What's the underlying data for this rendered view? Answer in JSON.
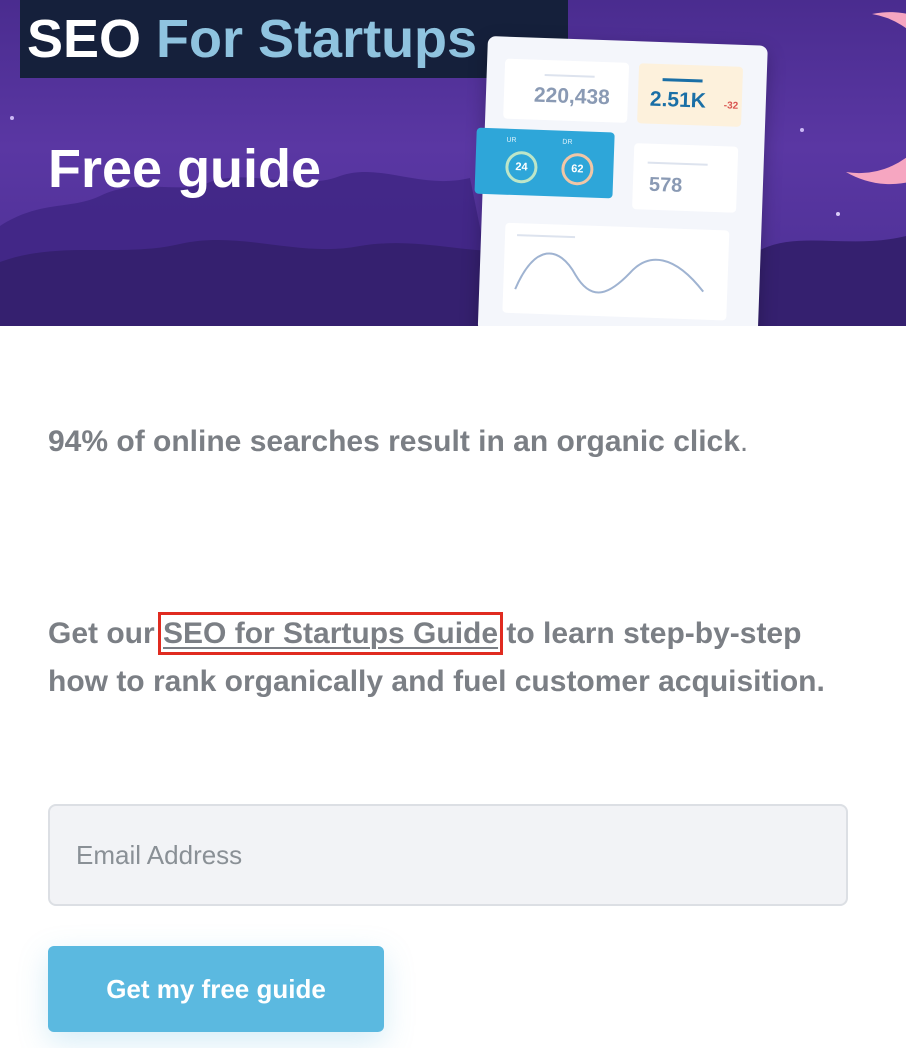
{
  "hero": {
    "brand_seo": "SEO",
    "brand_rest": " For Startups",
    "title": "Free guide",
    "dashboard": {
      "metric_1": "220,438",
      "metric_2": "2.51K",
      "metric_2_delta": "-32",
      "gauge_ur_label": "UR",
      "gauge_ur_value": "24",
      "gauge_dr_label": "DR",
      "gauge_dr_value": "62",
      "metric_3": "578"
    }
  },
  "body": {
    "stat_text": "94% of online searches result in an organic click",
    "stat_period": ".",
    "pitch_before": "Get our ",
    "pitch_link": "SEO for Startups Guide",
    "pitch_after": " to learn step-by-step how to rank organically and fuel customer acquisition."
  },
  "form": {
    "email_placeholder": "Email Address",
    "email_value": "",
    "submit_label": "Get my free guide"
  },
  "colors": {
    "hero_bg": "#4a2c8f",
    "brand_box": "#15203b",
    "brand_accent": "#8fc3df",
    "text_gray": "#7b7f85",
    "button_bg": "#5bb9e0",
    "highlight_box": "#e02b20"
  }
}
